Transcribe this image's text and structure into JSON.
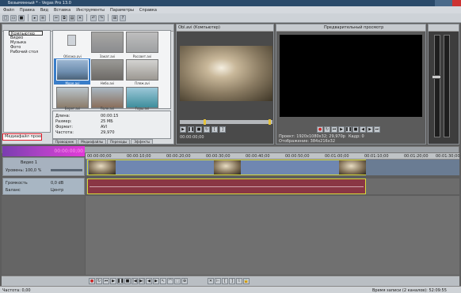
{
  "window": {
    "title": "Безымянный * - Vegas Pro 13.0"
  },
  "menu": [
    "Файл",
    "Правка",
    "Вид",
    "Вставка",
    "Инструменты",
    "Параметры",
    "Справка"
  ],
  "explorer": {
    "tree": [
      "Компьютер",
      "Видео",
      "Музыка",
      "Фото",
      "Рабочий стол"
    ],
    "thumbs": [
      {
        "label": "Облака.avi"
      },
      {
        "label": "Закат.avi"
      },
      {
        "label": "Рассвет.avi"
      },
      {
        "label": "Море.avi"
      },
      {
        "label": "Небо.avi"
      },
      {
        "label": "Пляж.avi"
      },
      {
        "label": "Берег.avi"
      },
      {
        "label": "Поле.avi"
      },
      {
        "label": "Горы.avi"
      }
    ],
    "props": [
      "Длина:",
      "Размер:",
      "Формат:",
      "Частота:"
    ],
    "props_vals": [
      "00:00:15",
      "25 МБ",
      "AVI",
      "29,970"
    ],
    "tabs": [
      "Проводник",
      "Медиафайлы",
      "Переходы",
      "Эффекты"
    ]
  },
  "trimmer": {
    "tab": "Obl.avi (Компьютер)",
    "timecode": "00:00:00;00"
  },
  "preview": {
    "label": "Предварительный просмотр",
    "info1": "Проект: 1920x1080x32; 29,970p",
    "info2": "Кадр: 0",
    "info3": "Отображение: 384x216x32"
  },
  "timeline": {
    "timecode": "00:00:00;00",
    "track1": {
      "name": "Видео 1",
      "level": "Уровень: 100,0 %"
    },
    "track2": {
      "name": "Аудио 1",
      "vol": "Громкость",
      "pan": "Баланс",
      "vol_val": "0,0 dB",
      "pan_val": "Центр"
    },
    "marker": "ССЫЛКА 1",
    "ruler_ticks": [
      "00:00:00;00",
      "00:00:10;00",
      "00:00:20;00",
      "00:00:30;00",
      "00:00:40;00",
      "00:00:50;00",
      "00:01:00;00",
      "00:01:10;00",
      "00:01:20;00",
      "00:01:30;00"
    ],
    "selection_label": "Медиафайл проекта"
  },
  "status": {
    "rate": "Частота: 0,00",
    "time": "Время записи (2 каналов): 52:09:55",
    "complete": "Выполнено: 00:00:00"
  },
  "colors": {
    "accent_pink": "#e23ad8",
    "selection_red": "#e11d2b",
    "audio_clip": "#8a3644",
    "video_track": "#5f7fa8"
  }
}
